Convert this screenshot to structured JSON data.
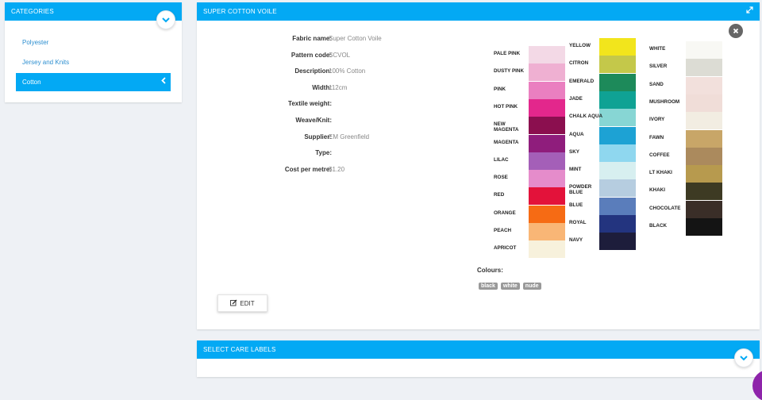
{
  "categories": {
    "title": "CATEGORIES",
    "items": [
      {
        "label": "Polyester",
        "active": false
      },
      {
        "label": "Jersey and Knits",
        "active": false
      },
      {
        "label": "Cotton",
        "active": true
      }
    ]
  },
  "fabric": {
    "title": "SUPER COTTON VOILE",
    "fields": [
      {
        "label": "Fabric name:",
        "value": "Super Cotton Voile"
      },
      {
        "label": "Pattern code:",
        "value": "SCVOL"
      },
      {
        "label": "Description:",
        "value": "100% Cotton"
      },
      {
        "label": "Width:",
        "value": "112cm"
      },
      {
        "label": "Textile weight:",
        "value": ""
      },
      {
        "label": "Weave/Knit:",
        "value": ""
      },
      {
        "label": "Supplier:",
        "value": "EM Greenfield"
      },
      {
        "label": "Type:",
        "value": ""
      },
      {
        "label": "Cost per metre:",
        "value": "$1.20"
      }
    ],
    "colours_label": "Colours:",
    "colours": [
      "black",
      "white",
      "nude"
    ],
    "edit_label": "EDIT"
  },
  "swatches": {
    "col1": [
      {
        "name": "PALE PINK",
        "color": "#f3d9e6"
      },
      {
        "name": "DUSTY PINK",
        "color": "#efb0d2"
      },
      {
        "name": "PINK",
        "color": "#ea7fc0"
      },
      {
        "name": "HOT PINK",
        "color": "#e3278c"
      },
      {
        "name": "NEW MAGENTA",
        "color": "#8b0f4f"
      },
      {
        "name": "MAGENTA",
        "color": "#8f1d7c"
      },
      {
        "name": "LILAC",
        "color": "#a45fb8"
      },
      {
        "name": "ROSE",
        "color": "#e58ccb"
      },
      {
        "name": "RED",
        "color": "#e3123a"
      },
      {
        "name": "ORANGE",
        "color": "#f66b14"
      },
      {
        "name": "PEACH",
        "color": "#f9b676"
      },
      {
        "name": "APRICOT",
        "color": "#f7f1dc"
      }
    ],
    "col2": [
      {
        "name": "YELLOW",
        "color": "#f2e51c"
      },
      {
        "name": "CITRON",
        "color": "#c4c84a"
      },
      {
        "name": "EMERALD",
        "color": "#1d8a5a"
      },
      {
        "name": "JADE",
        "color": "#0fa294"
      },
      {
        "name": "CHALK AQUA",
        "color": "#87d6d4"
      },
      {
        "name": "AQUA",
        "color": "#1da2d4"
      },
      {
        "name": "SKY",
        "color": "#8fd7ef"
      },
      {
        "name": "MINT",
        "color": "#d7eff0"
      },
      {
        "name": "POWDER BLUE",
        "color": "#b6cde0"
      },
      {
        "name": "BLUE",
        "color": "#5a7dbb"
      },
      {
        "name": "ROYAL",
        "color": "#23347f"
      },
      {
        "name": "NAVY",
        "color": "#1d1d3b"
      }
    ],
    "col3": [
      {
        "name": "WHITE",
        "color": "#f8f8f4"
      },
      {
        "name": "SILVER",
        "color": "#dcdcd4"
      },
      {
        "name": "SAND",
        "color": "#f2e0dc"
      },
      {
        "name": "MUSHROOM",
        "color": "#f0ddd8"
      },
      {
        "name": "IVORY",
        "color": "#f2ede2"
      },
      {
        "name": "FAWN",
        "color": "#c8a668"
      },
      {
        "name": "COFFEE",
        "color": "#ab8a5d"
      },
      {
        "name": "LT KHAKI",
        "color": "#b79a4e"
      },
      {
        "name": "KHAKI",
        "color": "#3d3a23"
      },
      {
        "name": "CHOCOLATE",
        "color": "#3a2e28"
      },
      {
        "name": "BLACK",
        "color": "#141414"
      }
    ]
  },
  "care": {
    "title": "SELECT CARE LABELS"
  },
  "colors": {
    "accent": "#03a9f4",
    "fab": "#8e24aa"
  }
}
